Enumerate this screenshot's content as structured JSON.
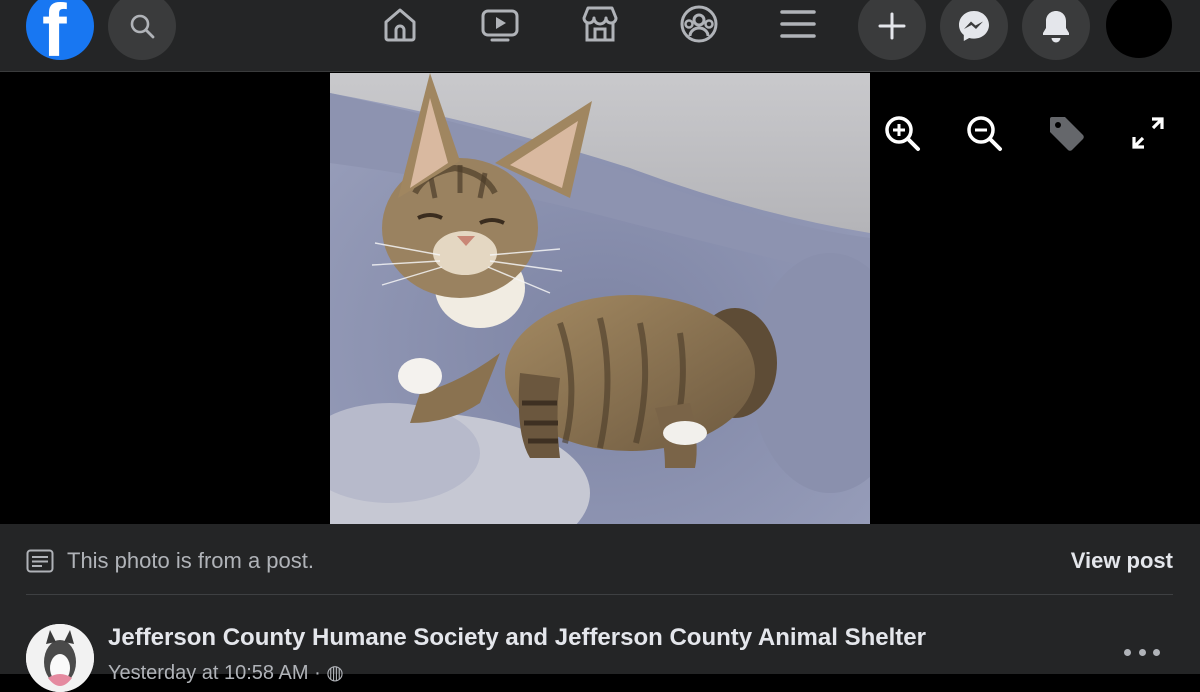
{
  "header": {
    "logo": "facebook-logo",
    "search_icon": "search-icon",
    "nav_items": [
      {
        "name": "home",
        "icon": "home-icon"
      },
      {
        "name": "watch",
        "icon": "video-icon"
      },
      {
        "name": "marketplace",
        "icon": "store-icon"
      },
      {
        "name": "groups",
        "icon": "groups-icon"
      },
      {
        "name": "menu",
        "icon": "menu-icon"
      }
    ],
    "actions": [
      "create-plus-icon",
      "messenger-icon",
      "notifications-bell-icon",
      "account-avatar"
    ]
  },
  "photo_viewer": {
    "tools": [
      "zoom-in-icon",
      "zoom-out-icon",
      "tag-icon",
      "fullscreen-icon"
    ],
    "image_subject": "tabby kitten on grey blanket"
  },
  "post_info": {
    "note": "This photo is from a post.",
    "view_post_label": "View post",
    "page_name": "Jefferson County Humane Society and Jefferson County Animal Shelter",
    "time": "Yesterday at 10:58 AM · ◍"
  },
  "colors": {
    "brand": "#1877f2",
    "bar_bg": "#242526",
    "button_bg": "#3a3b3c",
    "text_primary": "#e4e6eb",
    "text_secondary": "#b0b3b8"
  }
}
